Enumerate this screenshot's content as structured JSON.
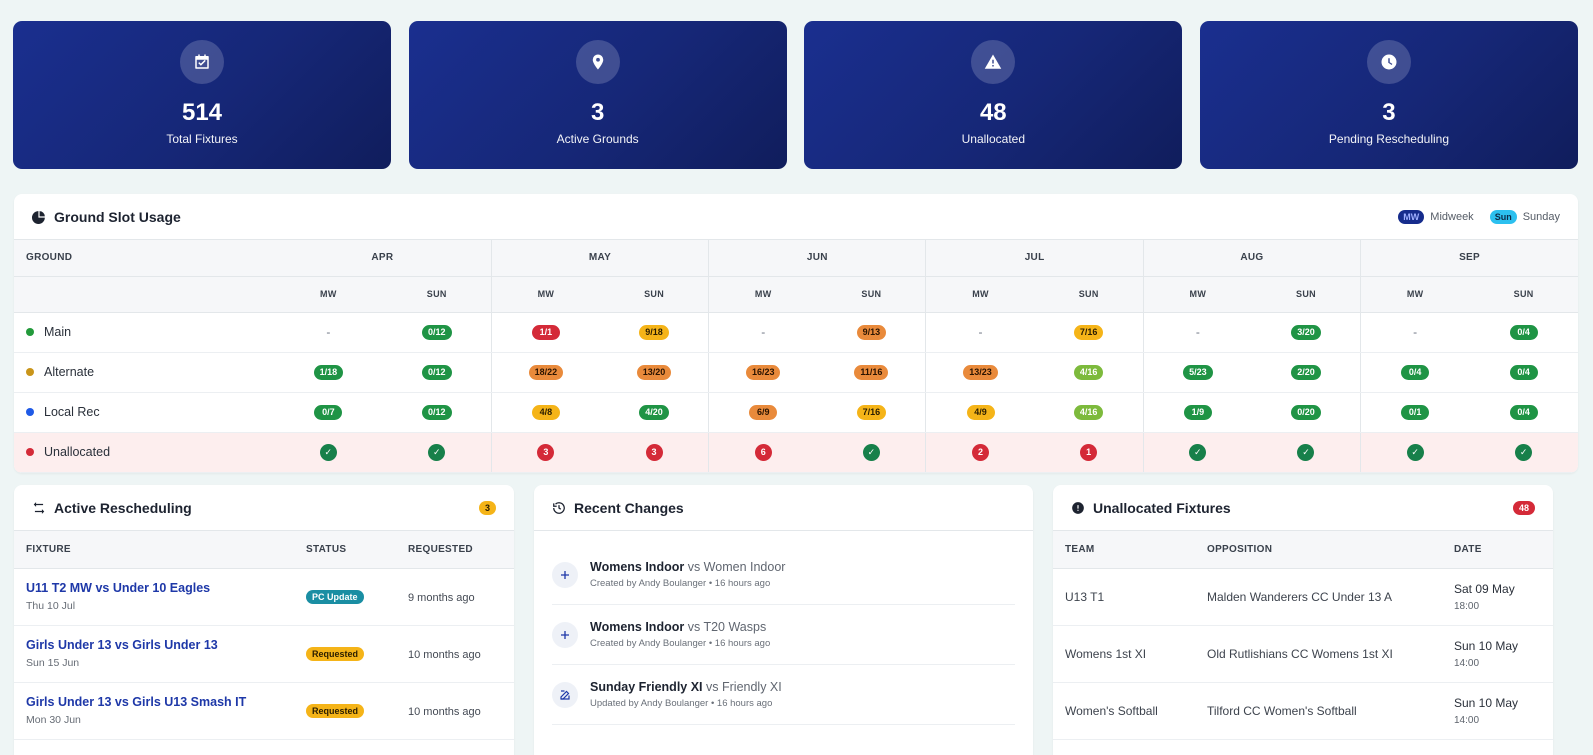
{
  "stats": [
    {
      "icon": "calendar-check-icon",
      "value": "514",
      "label": "Total Fixtures"
    },
    {
      "icon": "map-pin-icon",
      "value": "3",
      "label": "Active Grounds"
    },
    {
      "icon": "warning-icon",
      "value": "48",
      "label": "Unallocated"
    },
    {
      "icon": "clock-icon",
      "value": "3",
      "label": "Pending Rescheduling"
    }
  ],
  "usage": {
    "title": "Ground Slot Usage",
    "legend": {
      "mw_chip": "MW",
      "mw_label": "Midweek",
      "sun_chip": "Sun",
      "sun_label": "Sunday"
    },
    "ground_header": "GROUND",
    "months": [
      "APR",
      "MAY",
      "JUN",
      "JUL",
      "AUG",
      "SEP"
    ],
    "sub_mw": "MW",
    "sub_sun": "SUN",
    "rows": [
      {
        "name": "Main",
        "dot": "#239a3b",
        "cells": [
          {
            "t": "-",
            "c": "dash"
          },
          {
            "t": "0/12",
            "c": "g"
          },
          {
            "t": "1/1",
            "c": "r"
          },
          {
            "t": "9/18",
            "c": "y"
          },
          {
            "t": "-",
            "c": "dash"
          },
          {
            "t": "9/13",
            "c": "o"
          },
          {
            "t": "-",
            "c": "dash"
          },
          {
            "t": "7/16",
            "c": "y"
          },
          {
            "t": "-",
            "c": "dash"
          },
          {
            "t": "3/20",
            "c": "g"
          },
          {
            "t": "-",
            "c": "dash"
          },
          {
            "t": "0/4",
            "c": "g"
          }
        ]
      },
      {
        "name": "Alternate",
        "dot": "#c9951a",
        "cells": [
          {
            "t": "1/18",
            "c": "g"
          },
          {
            "t": "0/12",
            "c": "g"
          },
          {
            "t": "18/22",
            "c": "o"
          },
          {
            "t": "13/20",
            "c": "o"
          },
          {
            "t": "16/23",
            "c": "o"
          },
          {
            "t": "11/16",
            "c": "o"
          },
          {
            "t": "13/23",
            "c": "o"
          },
          {
            "t": "4/16",
            "c": "lg"
          },
          {
            "t": "5/23",
            "c": "g"
          },
          {
            "t": "2/20",
            "c": "g"
          },
          {
            "t": "0/4",
            "c": "g"
          },
          {
            "t": "0/4",
            "c": "g"
          }
        ]
      },
      {
        "name": "Local Rec",
        "dot": "#1f5ae6",
        "cells": [
          {
            "t": "0/7",
            "c": "g"
          },
          {
            "t": "0/12",
            "c": "g"
          },
          {
            "t": "4/8",
            "c": "y"
          },
          {
            "t": "4/20",
            "c": "g"
          },
          {
            "t": "6/9",
            "c": "o"
          },
          {
            "t": "7/16",
            "c": "y"
          },
          {
            "t": "4/9",
            "c": "y"
          },
          {
            "t": "4/16",
            "c": "lg"
          },
          {
            "t": "1/9",
            "c": "g"
          },
          {
            "t": "0/20",
            "c": "g"
          },
          {
            "t": "0/1",
            "c": "g"
          },
          {
            "t": "0/4",
            "c": "g"
          }
        ]
      },
      {
        "name": "Unallocated",
        "dot": "#d42a38",
        "cells": [
          {
            "t": "✓",
            "c": "ok"
          },
          {
            "t": "✓",
            "c": "ok"
          },
          {
            "t": "3",
            "c": "bad"
          },
          {
            "t": "3",
            "c": "bad"
          },
          {
            "t": "6",
            "c": "bad"
          },
          {
            "t": "✓",
            "c": "ok"
          },
          {
            "t": "2",
            "c": "bad"
          },
          {
            "t": "1",
            "c": "bad"
          },
          {
            "t": "✓",
            "c": "ok"
          },
          {
            "t": "✓",
            "c": "ok"
          },
          {
            "t": "✓",
            "c": "ok"
          },
          {
            "t": "✓",
            "c": "ok"
          }
        ]
      }
    ]
  },
  "rescheduling": {
    "title": "Active Rescheduling",
    "badge": "3",
    "headers": {
      "fixture": "FIXTURE",
      "status": "STATUS",
      "requested": "REQUESTED"
    },
    "rows": [
      {
        "fixture": "U11 T2 MW vs Under 10 Eagles",
        "date": "Thu 10 Jul",
        "status": "PC Update",
        "status_class": "st-pc",
        "requested": "9 months ago"
      },
      {
        "fixture": "Girls Under 13 vs Girls Under 13",
        "date": "Sun 15 Jun",
        "status": "Requested",
        "status_class": "st-req",
        "requested": "10 months ago"
      },
      {
        "fixture": "Girls Under 13 vs Girls U13 Smash IT",
        "date": "Mon 30 Jun",
        "status": "Requested",
        "status_class": "st-req",
        "requested": "10 months ago"
      }
    ]
  },
  "changes": {
    "title": "Recent Changes",
    "items": [
      {
        "icon": "plus-icon",
        "team": "Womens Indoor",
        "vs": "vs Women Indoor",
        "meta": "Created by Andy Boulanger • 16 hours ago"
      },
      {
        "icon": "plus-icon",
        "team": "Womens Indoor",
        "vs": "vs T20 Wasps",
        "meta": "Created by Andy Boulanger • 16 hours ago"
      },
      {
        "icon": "edit-icon",
        "team": "Sunday Friendly XI",
        "vs": "vs Friendly XI",
        "meta": "Updated by Andy Boulanger • 16 hours ago"
      }
    ]
  },
  "unallocated": {
    "title": "Unallocated Fixtures",
    "badge": "48",
    "headers": {
      "team": "TEAM",
      "opposition": "OPPOSITION",
      "date": "DATE"
    },
    "rows": [
      {
        "team": "U13 T1",
        "opposition": "Malden Wanderers CC Under 13 A",
        "date": "Sat 09 May",
        "time": "18:00"
      },
      {
        "team": "Womens 1st XI",
        "opposition": "Old Rutlishians CC Womens 1st XI",
        "date": "Sun 10 May",
        "time": "14:00"
      },
      {
        "team": "Women's Softball",
        "opposition": "Tilford CC Women's Softball",
        "date": "Sun 10 May",
        "time": "14:00"
      }
    ]
  }
}
